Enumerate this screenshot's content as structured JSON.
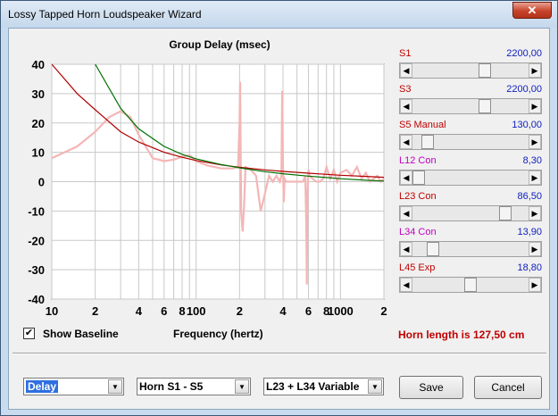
{
  "window": {
    "title": "Lossy Tapped Horn Loudspeaker Wizard",
    "close_label": "✕"
  },
  "chart_data": {
    "type": "line",
    "title": "Group Delay (msec)",
    "xlabel": "Frequency (hertz)",
    "ylabel": "",
    "xscale": "log",
    "xlim": [
      10,
      2000
    ],
    "ylim": [
      -40,
      40
    ],
    "x_ticks": [
      "10",
      "2",
      "4",
      "6",
      "8",
      "100",
      "2",
      "4",
      "6",
      "8",
      "1000",
      "2"
    ],
    "y_ticks": [
      "40",
      "30",
      "20",
      "10",
      "0",
      "-10",
      "-20",
      "-30",
      "-40"
    ],
    "grid": true,
    "colors": {
      "red": "#b00000",
      "green": "#007000",
      "pink": "#f4b6b6"
    },
    "series": [
      {
        "color": "#b00000",
        "x": [
          10,
          15,
          20,
          30,
          40,
          60,
          80,
          100,
          150,
          200,
          300,
          400,
          600,
          800,
          1000,
          1500,
          2000
        ],
        "y": [
          40,
          30,
          24.5,
          17,
          13.5,
          10,
          8.3,
          7.2,
          5.7,
          4.9,
          4.0,
          3.5,
          2.9,
          2.5,
          2.2,
          1.8,
          1.5
        ]
      },
      {
        "color": "#007000",
        "x": [
          20,
          30,
          40,
          60,
          80,
          100,
          150,
          200,
          300,
          400,
          600,
          800,
          1000,
          1500,
          2000
        ],
        "y": [
          40,
          25,
          18,
          12,
          9.3,
          7.8,
          5.8,
          4.7,
          3.4,
          2.7,
          1.9,
          1.4,
          1.0,
          0.5,
          0.2
        ]
      },
      {
        "color": "#f4b6b6",
        "x": [
          10,
          15,
          20,
          25,
          30,
          35,
          40,
          50,
          60,
          70,
          80,
          90,
          100,
          120,
          150,
          180,
          195,
          200,
          202,
          205,
          210,
          215,
          220,
          240,
          260,
          280,
          300,
          320,
          340,
          360,
          380,
          390,
          395,
          400,
          402,
          405,
          410,
          420,
          450,
          500,
          550,
          570,
          580,
          585,
          590,
          595,
          600,
          610,
          640,
          680,
          720,
          760,
          800,
          850,
          900,
          950,
          1000,
          1100,
          1200,
          1300,
          1400,
          1500,
          1600,
          1700,
          1800,
          1900,
          2000
        ],
        "y": [
          8,
          12,
          17,
          22,
          24,
          22,
          16,
          8,
          7,
          7.5,
          8.5,
          9,
          7,
          5.5,
          4.5,
          4.5,
          5,
          20,
          34,
          -10,
          -17,
          -8,
          5,
          4,
          2,
          -10,
          -4,
          2,
          0,
          2,
          0,
          2,
          31,
          5,
          0,
          -7,
          1,
          0,
          0,
          0,
          0,
          2,
          -15,
          -35,
          -5,
          0,
          4,
          2,
          1,
          0,
          0,
          1,
          5,
          1,
          4,
          0,
          3,
          4,
          2,
          5,
          1,
          3,
          0,
          1,
          2,
          0,
          1
        ]
      }
    ]
  },
  "controls": {
    "sliders": [
      {
        "label": "S1",
        "value": "2200,00",
        "label_color": "#c00000",
        "fraction": 0.64
      },
      {
        "label": "S3",
        "value": "2200,00",
        "label_color": "#c00000",
        "fraction": 0.64
      },
      {
        "label": "S5  Manual",
        "value": "130,00",
        "label_color": "#c00000",
        "fraction": 0.09
      },
      {
        "label": "L12  Con",
        "value": "8,30",
        "label_color": "#c000c0",
        "fraction": 0.0
      },
      {
        "label": "L23  Con",
        "value": "86,50",
        "label_color": "#c00000",
        "fraction": 0.84
      },
      {
        "label": "L34  Con",
        "value": "13,90",
        "label_color": "#c000c0",
        "fraction": 0.14
      },
      {
        "label": "L45  Exp",
        "value": "18,80",
        "label_color": "#c00000",
        "fraction": 0.5
      }
    ],
    "show_baseline_label": "Show Baseline",
    "show_baseline_checked": "✔",
    "frequency_label": "Frequency (hertz)",
    "horn_length_text": "Horn length is 127,50 cm"
  },
  "footer": {
    "combo1": "Delay",
    "combo2": "Horn S1 - S5",
    "combo3": "L23 + L34 Variable",
    "save_label": "Save",
    "cancel_label": "Cancel"
  }
}
